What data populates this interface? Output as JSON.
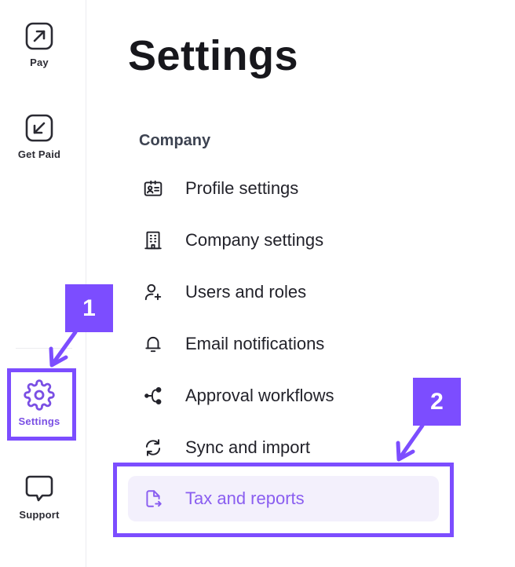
{
  "rail": {
    "items": [
      {
        "label": "Pay",
        "icon": "arrow-up-right-icon"
      },
      {
        "label": "Get Paid",
        "icon": "arrow-down-left-icon"
      },
      {
        "label": "Settings",
        "icon": "gear-icon",
        "active": true
      },
      {
        "label": "Support",
        "icon": "chat-bubble-icon"
      }
    ]
  },
  "main": {
    "title": "Settings",
    "section_label": "Company",
    "menu": [
      {
        "label": "Profile settings",
        "icon": "id-card-icon"
      },
      {
        "label": "Company settings",
        "icon": "building-icon"
      },
      {
        "label": "Users and roles",
        "icon": "user-plus-icon"
      },
      {
        "label": "Email notifications",
        "icon": "bell-icon"
      },
      {
        "label": "Approval workflows",
        "icon": "workflow-icon"
      },
      {
        "label": "Sync and import",
        "icon": "sync-icon"
      },
      {
        "label": "Tax and reports",
        "icon": "file-report-icon",
        "active": true
      }
    ]
  },
  "annotations": {
    "badge_1": "1",
    "badge_2": "2"
  },
  "colors": {
    "accent": "#7c4dff",
    "active_text": "#8a5ef0",
    "active_bg": "#f3f0fc",
    "text_dark": "#17171c",
    "section_text": "#3d4351"
  }
}
